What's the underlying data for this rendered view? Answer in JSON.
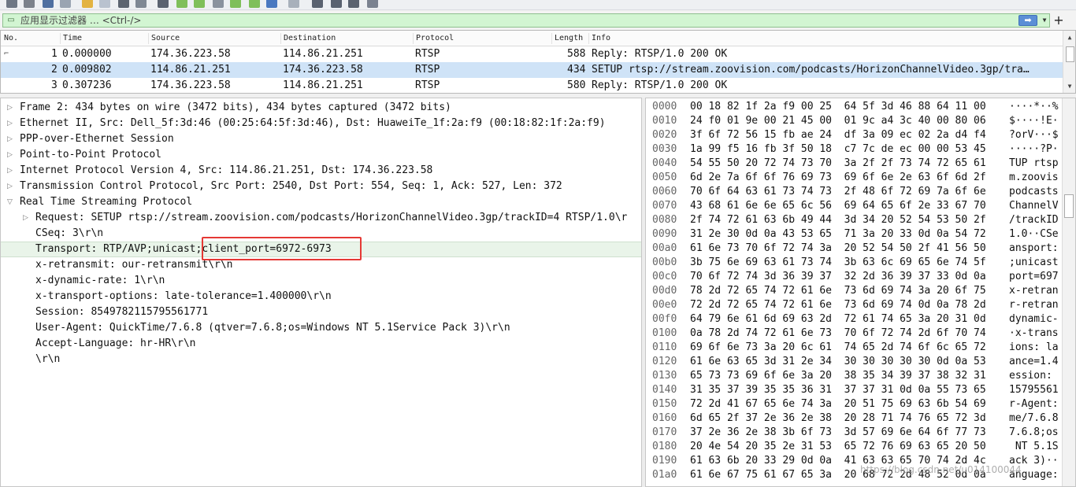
{
  "filter": {
    "placeholder": "应用显示过滤器 … <Ctrl-/>",
    "apply_icon": "right-arrow-icon",
    "dropdown_icon": "chevron-down-icon",
    "add_label": "+"
  },
  "packet_list": {
    "columns": [
      "No.",
      "Time",
      "Source",
      "Destination",
      "Protocol",
      "Length",
      "Info"
    ],
    "rows": [
      {
        "no": "1",
        "time": "0.000000",
        "source": "174.36.223.58",
        "destination": "114.86.21.251",
        "protocol": "RTSP",
        "length": "588",
        "info": "Reply: RTSP/1.0 200 OK"
      },
      {
        "no": "2",
        "time": "0.009802",
        "source": "114.86.21.251",
        "destination": "174.36.223.58",
        "protocol": "RTSP",
        "length": "434",
        "info": "SETUP rtsp://stream.zoovision.com/podcasts/HorizonChannelVideo.3gp/tra…"
      },
      {
        "no": "3",
        "time": "0.307236",
        "source": "174.36.223.58",
        "destination": "114.86.21.251",
        "protocol": "RTSP",
        "length": "580",
        "info": "Reply: RTSP/1.0 200 OK"
      }
    ],
    "selected_row": 2
  },
  "details": {
    "lines": [
      "Frame 2: 434 bytes on wire (3472 bits), 434 bytes captured (3472 bits)",
      "Ethernet II, Src: Dell_5f:3d:46 (00:25:64:5f:3d:46), Dst: HuaweiTe_1f:2a:f9 (00:18:82:1f:2a:f9)",
      "PPP-over-Ethernet Session",
      "Point-to-Point Protocol",
      "Internet Protocol Version 4, Src: 114.86.21.251, Dst: 174.36.223.58",
      "Transmission Control Protocol, Src Port: 2540, Dst Port: 554, Seq: 1, Ack: 527, Len: 372",
      "Real Time Streaming Protocol",
      "Request: SETUP rtsp://stream.zoovision.com/podcasts/HorizonChannelVideo.3gp/trackID=4 RTSP/1.0\\r",
      "CSeq: 3\\r\\n",
      "Transport: RTP/AVP;unicast;client_port=6972-6973",
      "x-retransmit: our-retransmit\\r\\n",
      "x-dynamic-rate: 1\\r\\n",
      "x-transport-options: late-tolerance=1.400000\\r\\n",
      "Session: 8549782115795561771",
      "User-Agent: QuickTime/7.6.8 (qtver=7.6.8;os=Windows NT 5.1Service Pack 3)\\r\\n",
      "Accept-Language: hr-HR\\r\\n",
      "\\r\\n"
    ]
  },
  "hex": {
    "rows": [
      {
        "offset": "0000",
        "bytes": "00 18 82 1f 2a f9 00 25  64 5f 3d 46 88 64 11 00",
        "ascii": "····*··% d"
      },
      {
        "offset": "0010",
        "bytes": "24 f0 01 9e 00 21 45 00  01 9c a4 3c 40 00 80 06",
        "ascii": "$····!E· "
      },
      {
        "offset": "0020",
        "bytes": "3f 6f 72 56 15 fb ae 24  df 3a 09 ec 02 2a d4 f4",
        "ascii": "?orV···$ "
      },
      {
        "offset": "0030",
        "bytes": "1a 99 f5 16 fb 3f 50 18  c7 7c de ec 00 00 53 45",
        "ascii": "·····?P· "
      },
      {
        "offset": "0040",
        "bytes": "54 55 50 20 72 74 73 70  3a 2f 2f 73 74 72 65 61",
        "ascii": "TUP rtsp :"
      },
      {
        "offset": "0050",
        "bytes": "6d 2e 7a 6f 6f 76 69 73  69 6f 6e 2e 63 6f 6d 2f",
        "ascii": "m.zoovis i"
      },
      {
        "offset": "0060",
        "bytes": "70 6f 64 63 61 73 74 73  2f 48 6f 72 69 7a 6f 6e",
        "ascii": "podcasts /"
      },
      {
        "offset": "0070",
        "bytes": "43 68 61 6e 6e 65 6c 56  69 64 65 6f 2e 33 67 70",
        "ascii": "ChannelV i"
      },
      {
        "offset": "0080",
        "bytes": "2f 74 72 61 63 6b 49 44  3d 34 20 52 54 53 50 2f",
        "ascii": "/trackID ="
      },
      {
        "offset": "0090",
        "bytes": "31 2e 30 0d 0a 43 53 65  71 3a 20 33 0d 0a 54 72",
        "ascii": "1.0··CSe q"
      },
      {
        "offset": "00a0",
        "bytes": "61 6e 73 70 6f 72 74 3a  20 52 54 50 2f 41 56 50",
        "ascii": "ansport: "
      },
      {
        "offset": "00b0",
        "bytes": "3b 75 6e 69 63 61 73 74  3b 63 6c 69 65 6e 74 5f",
        "ascii": ";unicast ;"
      },
      {
        "offset": "00c0",
        "bytes": "70 6f 72 74 3d 36 39 37  32 2d 36 39 37 33 0d 0a",
        "ascii": "port=697 2"
      },
      {
        "offset": "00d0",
        "bytes": "78 2d 72 65 74 72 61 6e  73 6d 69 74 3a 20 6f 75",
        "ascii": "x-retran s"
      },
      {
        "offset": "00e0",
        "bytes": "72 2d 72 65 74 72 61 6e  73 6d 69 74 0d 0a 78 2d",
        "ascii": "r-retran s"
      },
      {
        "offset": "00f0",
        "bytes": "64 79 6e 61 6d 69 63 2d  72 61 74 65 3a 20 31 0d",
        "ascii": "dynamic- r"
      },
      {
        "offset": "0100",
        "bytes": "0a 78 2d 74 72 61 6e 73  70 6f 72 74 2d 6f 70 74",
        "ascii": "·x-trans p"
      },
      {
        "offset": "0110",
        "bytes": "69 6f 6e 73 3a 20 6c 61  74 65 2d 74 6f 6c 65 72",
        "ascii": "ions: la t"
      },
      {
        "offset": "0120",
        "bytes": "61 6e 63 65 3d 31 2e 34  30 30 30 30 30 0d 0a 53",
        "ascii": "ance=1.4 0"
      },
      {
        "offset": "0130",
        "bytes": "65 73 73 69 6f 6e 3a 20  38 35 34 39 37 38 32 31",
        "ascii": "ession:  8"
      },
      {
        "offset": "0140",
        "bytes": "31 35 37 39 35 35 36 31  37 37 31 0d 0a 55 73 65",
        "ascii": "15795561 7"
      },
      {
        "offset": "0150",
        "bytes": "72 2d 41 67 65 6e 74 3a  20 51 75 69 63 6b 54 69",
        "ascii": "r-Agent:  "
      },
      {
        "offset": "0160",
        "bytes": "6d 65 2f 37 2e 36 2e 38  20 28 71 74 76 65 72 3d",
        "ascii": "me/7.6.8  "
      },
      {
        "offset": "0170",
        "bytes": "37 2e 36 2e 38 3b 6f 73  3d 57 69 6e 64 6f 77 73",
        "ascii": "7.6.8;os ="
      },
      {
        "offset": "0180",
        "bytes": "20 4e 54 20 35 2e 31 53  65 72 76 69 63 65 20 50",
        "ascii": " NT 5.1S e"
      },
      {
        "offset": "0190",
        "bytes": "61 63 6b 20 33 29 0d 0a  41 63 63 65 70 74 2d 4c",
        "ascii": "ack 3)·· A"
      },
      {
        "offset": "01a0",
        "bytes": "61 6e 67 75 61 67 65 3a  20 68 72 2d 48 52 0d 0a",
        "ascii": "anguage:  "
      }
    ]
  },
  "watermark": "https://blog.csdn.net/u014100044",
  "colors": {
    "filter_bg": "#d2f5d2",
    "selected_row": "#cfe3f7",
    "highlight_row": "#e9f4e9",
    "annotation_box": "#e53935"
  }
}
